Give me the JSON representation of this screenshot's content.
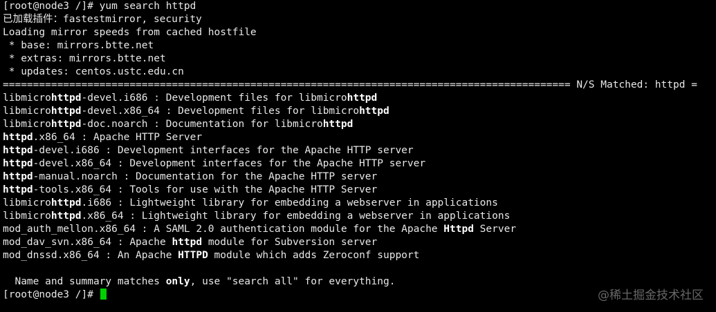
{
  "terminal": {
    "lines": [
      [
        {
          "t": "[root@node3 /]# yum search httpd"
        }
      ],
      [
        {
          "t": "已加载插件：fastestmirror, security"
        }
      ],
      [
        {
          "t": "Loading mirror speeds from cached hostfile"
        }
      ],
      [
        {
          "t": " * base: mirrors.btte.net"
        }
      ],
      [
        {
          "t": " * extras: mirrors.btte.net"
        }
      ],
      [
        {
          "t": " * updates: centos.ustc.edu.cn"
        }
      ],
      [
        {
          "t": "============================================================================================== N/S Matched: httpd ="
        }
      ],
      [
        {
          "t": "libmicro"
        },
        {
          "t": "httpd",
          "b": true
        },
        {
          "t": "-devel.i686 : Development files for libmicro"
        },
        {
          "t": "httpd",
          "b": true
        }
      ],
      [
        {
          "t": "libmicro"
        },
        {
          "t": "httpd",
          "b": true
        },
        {
          "t": "-devel.x86_64 : Development files for libmicro"
        },
        {
          "t": "httpd",
          "b": true
        }
      ],
      [
        {
          "t": "libmicro"
        },
        {
          "t": "httpd",
          "b": true
        },
        {
          "t": "-doc.noarch : Documentation for libmicro"
        },
        {
          "t": "httpd",
          "b": true
        }
      ],
      [
        {
          "t": "httpd",
          "b": true
        },
        {
          "t": ".x86_64 : Apache HTTP Server"
        }
      ],
      [
        {
          "t": "httpd",
          "b": true
        },
        {
          "t": "-devel.i686 : Development interfaces for the Apache HTTP server"
        }
      ],
      [
        {
          "t": "httpd",
          "b": true
        },
        {
          "t": "-devel.x86_64 : Development interfaces for the Apache HTTP server"
        }
      ],
      [
        {
          "t": "httpd",
          "b": true
        },
        {
          "t": "-manual.noarch : Documentation for the Apache HTTP server"
        }
      ],
      [
        {
          "t": "httpd",
          "b": true
        },
        {
          "t": "-tools.x86_64 : Tools for use with the Apache HTTP Server"
        }
      ],
      [
        {
          "t": "libmicro"
        },
        {
          "t": "httpd",
          "b": true
        },
        {
          "t": ".i686 : Lightweight library for embedding a webserver in applications"
        }
      ],
      [
        {
          "t": "libmicro"
        },
        {
          "t": "httpd",
          "b": true
        },
        {
          "t": ".x86_64 : Lightweight library for embedding a webserver in applications"
        }
      ],
      [
        {
          "t": "mod_auth_mellon.x86_64 : A SAML 2.0 authentication module for the Apache "
        },
        {
          "t": "Httpd",
          "b": true
        },
        {
          "t": " Server"
        }
      ],
      [
        {
          "t": "mod_dav_svn.x86_64 : Apache "
        },
        {
          "t": "httpd",
          "b": true
        },
        {
          "t": " module for Subversion server"
        }
      ],
      [
        {
          "t": "mod_dnssd.x86_64 : An Apache "
        },
        {
          "t": "HTTPD",
          "b": true
        },
        {
          "t": " module which adds Zeroconf support"
        }
      ],
      [
        {
          "t": ""
        }
      ],
      [
        {
          "t": "  Name and summary matches "
        },
        {
          "t": "only",
          "b": true
        },
        {
          "t": ", use \"search all\" for everything."
        }
      ],
      [
        {
          "t": "[root@node3 /]# "
        },
        {
          "cursor": true
        }
      ]
    ]
  },
  "watermark": "@稀土掘金技术社区",
  "colors": {
    "background": "#000000",
    "text": "#e8e8e8",
    "cursor": "#00d000"
  }
}
